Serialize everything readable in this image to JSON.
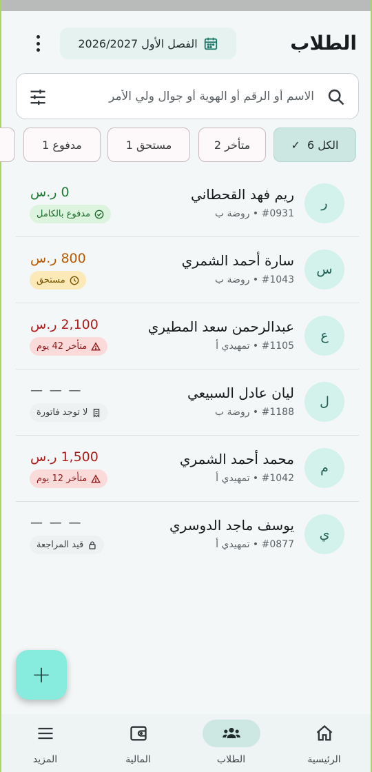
{
  "header": {
    "title": "الطلاب",
    "term": "الفصل الأول 2026/2027"
  },
  "search": {
    "placeholder": "الاسم أو الرقم أو الهوية أو جوال ولي الأمر"
  },
  "filters": [
    {
      "label": "الكل 6",
      "active": true
    },
    {
      "label": "متأخر 2",
      "active": false
    },
    {
      "label": "مستحق 1",
      "active": false
    },
    {
      "label": "مدفوع 1",
      "active": false
    }
  ],
  "students": [
    {
      "initial": "ر",
      "name": "ريم فهد القحطاني",
      "sub": "#0931 • روضة ب",
      "amount": "0 ر.س",
      "status": "مدفوع بالكامل",
      "type": "paid"
    },
    {
      "initial": "س",
      "name": "سارة أحمد الشمري",
      "sub": "#1043 • روضة ب",
      "amount": "800 ر.س",
      "status": "مستحق",
      "type": "due"
    },
    {
      "initial": "ع",
      "name": "عبدالرحمن سعد المطيري",
      "sub": "#1105 • تمهيدي أ",
      "amount": "2,100 ر.س",
      "status": "متأخر 42 يوم",
      "type": "late"
    },
    {
      "initial": "ل",
      "name": "ليان عادل السبيعي",
      "sub": "#1188 • روضة ب",
      "amount": "— — —",
      "status": "لا توجد فاتورة",
      "type": "none"
    },
    {
      "initial": "م",
      "name": "محمد أحمد الشمري",
      "sub": "#1042 • تمهيدي أ",
      "amount": "1,500 ر.س",
      "status": "متأخر 12 يوم",
      "type": "late"
    },
    {
      "initial": "ي",
      "name": "يوسف ماجد الدوسري",
      "sub": "#0877 • تمهيدي أ",
      "amount": "— — —",
      "status": "قيد المراجعة",
      "type": "review"
    }
  ],
  "colors": {
    "paid": "#1f7a33",
    "due": "#b65a00",
    "late": "#b01c1c",
    "none": "#444444",
    "accent": "#87ebdd"
  },
  "fab": {
    "label": "+"
  },
  "nav": [
    {
      "label": "الرئيسية",
      "icon": "home-icon",
      "active": false
    },
    {
      "label": "الطلاب",
      "icon": "people-icon",
      "active": true
    },
    {
      "label": "المالية",
      "icon": "wallet-icon",
      "active": false
    },
    {
      "label": "المزيد",
      "icon": "menu-icon",
      "active": false
    }
  ]
}
